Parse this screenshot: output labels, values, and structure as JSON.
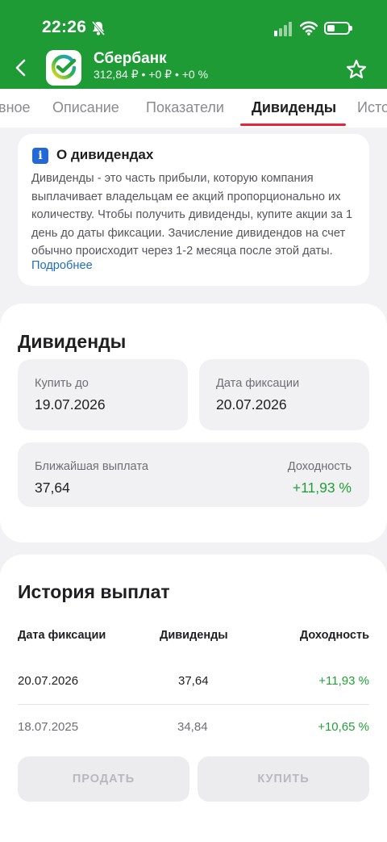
{
  "status_bar": {
    "time": "22:26"
  },
  "header": {
    "title": "Сбербанк",
    "subtitle": "312,84 ₽ • +0 ₽ • +0 %"
  },
  "tabs": [
    {
      "label": "вное"
    },
    {
      "label": "Описание"
    },
    {
      "label": "Показатели"
    },
    {
      "label": "Дивиденды",
      "active": true
    },
    {
      "label": "Исто"
    }
  ],
  "info": {
    "title": "О дивидендах",
    "text": "Дивиденды - это часть прибыли, которую компания выплачивает владельцам ее акций пропорционально их количеству. Чтобы получить дивиденды, купите акции за 1 день до даты фиксации. Зачисление дивидендов на счет обычно происходит через 1-2 месяца после этой даты.",
    "link": "Подробнее"
  },
  "dividends": {
    "title": "Дивиденды",
    "buy_by_label": "Купить до",
    "buy_by_value": "19.07.2026",
    "record_label": "Дата фиксации",
    "record_value": "20.07.2026",
    "next_label": "Ближайшая выплата",
    "next_value": "37,64",
    "yield_label": "Доходность",
    "yield_value": "+11,93 %"
  },
  "history": {
    "title": "История выплат",
    "columns": [
      "Дата фиксации",
      "Дивиденды",
      "Доходность"
    ],
    "rows": [
      {
        "date": "20.07.2026",
        "amount": "37,64",
        "yield": "+11,93 %"
      },
      {
        "date": "18.07.2025",
        "amount": "34,84",
        "yield": "+10,65 %"
      }
    ]
  },
  "actions": {
    "sell": "ПРОДАТЬ",
    "buy": "КУПИТЬ"
  },
  "colors": {
    "brand_green": "#1f9b35",
    "accent_red": "#e8233c",
    "positive": "#21a038",
    "link": "#1e6cc7"
  }
}
